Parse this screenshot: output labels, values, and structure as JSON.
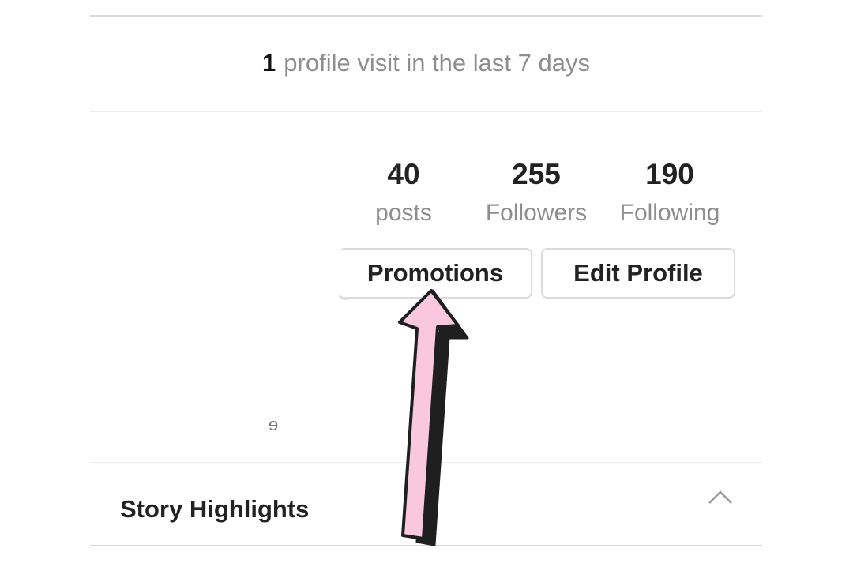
{
  "visits": {
    "count": "1",
    "text": "profile visit in the last 7 days"
  },
  "stats": [
    {
      "value": "40",
      "label": "posts"
    },
    {
      "value": "255",
      "label": "Followers"
    },
    {
      "value": "190",
      "label": "Following"
    }
  ],
  "buttons": {
    "promotions": "Promotions",
    "edit_profile": "Edit Profile"
  },
  "highlights": {
    "title": "Story Highlights"
  },
  "colors": {
    "arrow_fill": "#f9c8df",
    "arrow_outline": "#1f1f1f"
  },
  "icons": {
    "collapse": "chevron-up-icon",
    "annotation": "arrow-annotation"
  }
}
